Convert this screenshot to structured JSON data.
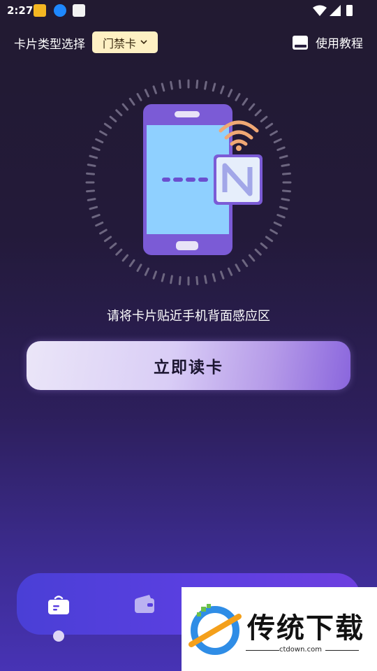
{
  "status_bar": {
    "time": "2:27"
  },
  "header": {
    "card_type_label": "卡片类型选择",
    "card_type_selected": "门禁卡",
    "tutorial_label": "使用教程"
  },
  "main": {
    "hint": "请将卡片贴近手机背面感应区",
    "read_button": "立即读卡"
  },
  "watermark": {
    "title": "传统下载",
    "url": "ctdown.com"
  },
  "colors": {
    "accent": "#7b5bd6",
    "select_bg": "#fef0c3",
    "phone_screen": "#8fd0ff",
    "wifi_orange": "#f0a874"
  },
  "icons": [
    "wifi-icon",
    "signal-icon",
    "battery-icon",
    "book-icon",
    "chevron-down-icon",
    "nfc-icon",
    "card-reader-icon",
    "wallet-icon"
  ]
}
